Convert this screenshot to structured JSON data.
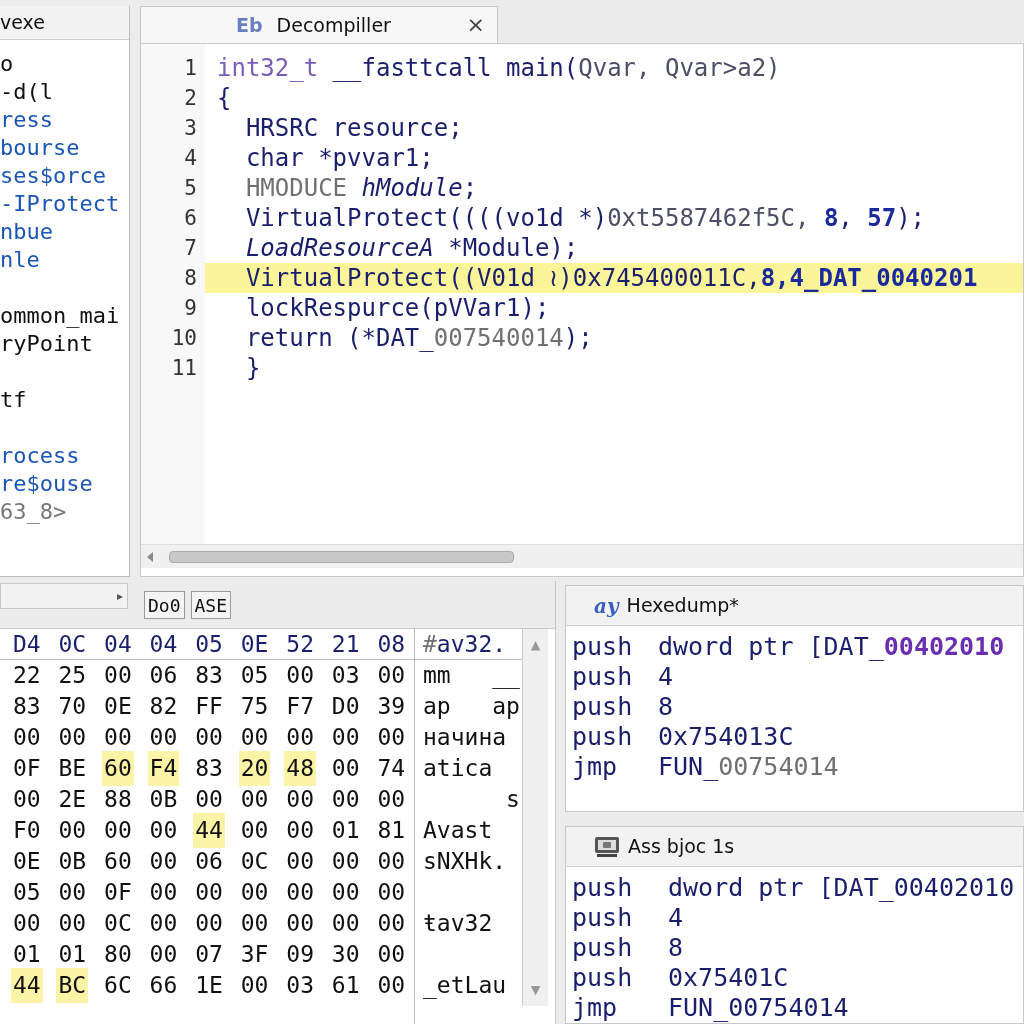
{
  "sidebar": {
    "title": "vexe",
    "items": [
      {
        "text": "o",
        "kind": "plain",
        "gap_before": false
      },
      {
        "text": "-d(l",
        "kind": "plain",
        "gap_before": false
      },
      {
        "text": "ress",
        "kind": "link",
        "gap_before": false
      },
      {
        "text": "bourse",
        "kind": "link",
        "gap_before": false
      },
      {
        "text": "ses$orce",
        "kind": "link",
        "gap_before": false
      },
      {
        "text": "-IProtect",
        "kind": "link",
        "gap_before": false
      },
      {
        "text": "nbue",
        "kind": "link",
        "gap_before": false
      },
      {
        "text": "nle",
        "kind": "link",
        "gap_before": false
      },
      {
        "text": "ommon_mai",
        "kind": "plain",
        "gap_before": true
      },
      {
        "text": "ryPoint",
        "kind": "plain",
        "gap_before": false
      },
      {
        "text": "tf",
        "kind": "plain",
        "gap_before": true
      },
      {
        "text": "rocess",
        "kind": "link",
        "gap_before": true
      },
      {
        "text": "re$ouse",
        "kind": "link",
        "gap_before": false
      },
      {
        "text": "63_8>",
        "kind": "dim",
        "gap_before": false
      }
    ],
    "scroll_arrow": "▸"
  },
  "editor": {
    "tab": {
      "icon": "Eb",
      "title": "Decompiller",
      "close": "×"
    },
    "lines": [
      {
        "number": "1",
        "highlighted": false,
        "segments": [
          {
            "text": "int32_t",
            "kind": "keyword"
          },
          {
            "text": " __fasttcall main(",
            "kind": "plain"
          },
          {
            "text": "Qvar, Qvar>a2)",
            "kind": "muted"
          }
        ]
      },
      {
        "number": "2",
        "highlighted": false,
        "segments": [
          {
            "text": "{",
            "kind": "plain"
          }
        ]
      },
      {
        "number": "3",
        "highlighted": false,
        "segments": [
          {
            "text": "  HRSRC resource;",
            "kind": "plain"
          }
        ]
      },
      {
        "number": "4",
        "highlighted": false,
        "segments": [
          {
            "text": "  char *pvvar1;",
            "kind": "plain"
          }
        ]
      },
      {
        "number": "5",
        "highlighted": false,
        "segments": [
          {
            "text": "  HMODUCE ",
            "kind": "dim"
          },
          {
            "text": "hModule",
            "kind": "italic"
          },
          {
            "text": ";",
            "kind": "plain"
          }
        ]
      },
      {
        "number": "6",
        "highlighted": false,
        "segments": [
          {
            "text": "  VirtualProtect((((vo1d *)",
            "kind": "plain"
          },
          {
            "text": "0xt5587462f5C, ",
            "kind": "muted"
          },
          {
            "text": "8",
            "kind": "number"
          },
          {
            "text": ", ",
            "kind": "plain"
          },
          {
            "text": "57",
            "kind": "number"
          },
          {
            "text": ");",
            "kind": "plain"
          }
        ]
      },
      {
        "number": "7",
        "highlighted": false,
        "segments": [
          {
            "text": "  LoadResourceA",
            "kind": "italic"
          },
          {
            "text": " *Module);",
            "kind": "plain"
          }
        ]
      },
      {
        "number": "8",
        "highlighted": true,
        "segments": [
          {
            "text": "  VirtualProtect((V01d ≀)0x745400011C,",
            "kind": "plain"
          },
          {
            "text": "8",
            "kind": "number"
          },
          {
            "text": ",4_DAT_0040201",
            "kind": "number"
          }
        ]
      },
      {
        "number": "9",
        "highlighted": false,
        "segments": [
          {
            "text": "  lockRespurce(pVVar1);",
            "kind": "plain"
          }
        ]
      },
      {
        "number": "10",
        "highlighted": false,
        "segments": [
          {
            "text": "  return (*DAT_",
            "kind": "plain"
          },
          {
            "text": "007540014",
            "kind": "dim"
          },
          {
            "text": ");",
            "kind": "plain"
          }
        ]
      },
      {
        "number": "11",
        "highlighted": false,
        "segments": [
          {
            "text": "  }",
            "kind": "plain"
          }
        ]
      }
    ]
  },
  "hex": {
    "buttons": [
      "Do0",
      "ASE"
    ],
    "header": {
      "bytes": [
        "D4",
        "0C",
        "04",
        "04",
        "05",
        "0E",
        "52",
        "21",
        "08"
      ],
      "ascii": [
        {
          "text": "#",
          "kind": "dim"
        },
        {
          "text": "av32.",
          "kind": "plain"
        }
      ]
    },
    "rows": [
      {
        "ascii": "mm   __",
        "bytes": [
          {
            "value": "22",
            "highlighted": false
          },
          {
            "value": "25",
            "highlighted": false
          },
          {
            "value": "00",
            "highlighted": false
          },
          {
            "value": "06",
            "highlighted": false
          },
          {
            "value": "83",
            "highlighted": false
          },
          {
            "value": "05",
            "highlighted": false
          },
          {
            "value": "00",
            "highlighted": false
          },
          {
            "value": "03",
            "highlighted": false
          },
          {
            "value": "00",
            "highlighted": false
          }
        ]
      },
      {
        "ascii": "ap   ap",
        "bytes": [
          {
            "value": "83",
            "highlighted": false
          },
          {
            "value": "70",
            "highlighted": false
          },
          {
            "value": "0E",
            "highlighted": false
          },
          {
            "value": "82",
            "highlighted": false
          },
          {
            "value": "FF",
            "highlighted": false
          },
          {
            "value": "75",
            "highlighted": false
          },
          {
            "value": "F7",
            "highlighted": false
          },
          {
            "value": "D0",
            "highlighted": false
          },
          {
            "value": "39",
            "highlighted": false
          }
        ]
      },
      {
        "ascii": "начина",
        "bytes": [
          {
            "value": "00",
            "highlighted": false
          },
          {
            "value": "00",
            "highlighted": false
          },
          {
            "value": "00",
            "highlighted": false
          },
          {
            "value": "00",
            "highlighted": false
          },
          {
            "value": "00",
            "highlighted": false
          },
          {
            "value": "00",
            "highlighted": false
          },
          {
            "value": "00",
            "highlighted": false
          },
          {
            "value": "00",
            "highlighted": false
          },
          {
            "value": "00",
            "highlighted": false
          }
        ]
      },
      {
        "ascii": "atica",
        "bytes": [
          {
            "value": "0F",
            "highlighted": false
          },
          {
            "value": "BE",
            "highlighted": false
          },
          {
            "value": "60",
            "highlighted": true
          },
          {
            "value": "F4",
            "highlighted": true
          },
          {
            "value": "83",
            "highlighted": false
          },
          {
            "value": "20",
            "highlighted": true
          },
          {
            "value": "48",
            "highlighted": true
          },
          {
            "value": "00",
            "highlighted": false
          },
          {
            "value": "74",
            "highlighted": false
          }
        ]
      },
      {
        "ascii": "      s",
        "bytes": [
          {
            "value": "00",
            "highlighted": false
          },
          {
            "value": "2E",
            "highlighted": false
          },
          {
            "value": "88",
            "highlighted": false
          },
          {
            "value": "0B",
            "highlighted": false
          },
          {
            "value": "00",
            "highlighted": false
          },
          {
            "value": "00",
            "highlighted": false
          },
          {
            "value": "00",
            "highlighted": false
          },
          {
            "value": "00",
            "highlighted": false
          },
          {
            "value": "00",
            "highlighted": false
          }
        ]
      },
      {
        "ascii": "Avast",
        "bytes": [
          {
            "value": "F0",
            "highlighted": false
          },
          {
            "value": "00",
            "highlighted": false
          },
          {
            "value": "00",
            "highlighted": false
          },
          {
            "value": "00",
            "highlighted": false
          },
          {
            "value": "44",
            "highlighted": true
          },
          {
            "value": "00",
            "highlighted": false
          },
          {
            "value": "00",
            "highlighted": false
          },
          {
            "value": "01",
            "highlighted": false
          },
          {
            "value": "81",
            "highlighted": false
          }
        ]
      },
      {
        "ascii": "sNXHk.",
        "bytes": [
          {
            "value": "0E",
            "highlighted": false
          },
          {
            "value": "0B",
            "highlighted": false
          },
          {
            "value": "60",
            "highlighted": false
          },
          {
            "value": "00",
            "highlighted": false
          },
          {
            "value": "06",
            "highlighted": false
          },
          {
            "value": "0C",
            "highlighted": false
          },
          {
            "value": "00",
            "highlighted": false
          },
          {
            "value": "00",
            "highlighted": false
          },
          {
            "value": "00",
            "highlighted": false
          }
        ]
      },
      {
        "bytes": [
          {
            "value": "05",
            "highlighted": false
          },
          {
            "value": "00",
            "highlighted": false
          },
          {
            "value": "0F",
            "highlighted": false
          },
          {
            "value": "00",
            "highlighted": false
          },
          {
            "value": "00",
            "highlighted": false
          },
          {
            "value": "00",
            "highlighted": false
          },
          {
            "value": "00",
            "highlighted": false
          },
          {
            "value": "00",
            "highlighted": false
          },
          {
            "value": "00",
            "highlighted": false
          }
        ]
      },
      {
        "ascii": "ŧav32",
        "bytes": [
          {
            "value": "00",
            "highlighted": false
          },
          {
            "value": "00",
            "highlighted": false
          },
          {
            "value": "0C",
            "highlighted": false
          },
          {
            "value": "00",
            "highlighted": false
          },
          {
            "value": "00",
            "highlighted": false
          },
          {
            "value": "00",
            "highlighted": false
          },
          {
            "value": "00",
            "highlighted": false
          },
          {
            "value": "00",
            "highlighted": false
          },
          {
            "value": "00",
            "highlighted": false
          }
        ]
      },
      {
        "bytes": [
          {
            "value": "01",
            "highlighted": false
          },
          {
            "value": "01",
            "highlighted": false
          },
          {
            "value": "80",
            "highlighted": false
          },
          {
            "value": "00",
            "highlighted": false
          },
          {
            "value": "07",
            "highlighted": false
          },
          {
            "value": "3F",
            "highlighted": false
          },
          {
            "value": "09",
            "highlighted": false
          },
          {
            "value": "30",
            "highlighted": false
          },
          {
            "value": "00",
            "highlighted": false
          }
        ]
      },
      {
        "ascii": "_etLau",
        "bytes": [
          {
            "value": "44",
            "highlighted": true
          },
          {
            "value": "BC",
            "highlighted": true
          },
          {
            "value": "6C",
            "highlighted": false
          },
          {
            "value": "66",
            "highlighted": false
          },
          {
            "value": "1E",
            "highlighted": false
          },
          {
            "value": "00",
            "highlighted": false
          },
          {
            "value": "03",
            "highlighted": false
          },
          {
            "value": "61",
            "highlighted": false
          },
          {
            "value": "00",
            "highlighted": false
          }
        ]
      }
    ],
    "scroll_up": "▲",
    "scroll_down": "▼"
  },
  "panels": [
    {
      "title": "Hexedump*",
      "icon": "ay",
      "kind": "hexdump",
      "lines": [
        {
          "mnemonic": "push",
          "operand": [
            {
              "text": "dword ptr [DAT_",
              "kind": "plain"
            },
            {
              "text": "00402010",
              "kind": "accent"
            }
          ]
        },
        {
          "mnemonic": "push",
          "operand": [
            {
              "text": "4",
              "kind": "plain"
            }
          ]
        },
        {
          "mnemonic": "push",
          "operand": [
            {
              "text": "8",
              "kind": "plain"
            }
          ]
        },
        {
          "mnemonic": "push",
          "operand": [
            {
              "text": "0x754013C",
              "kind": "plain"
            }
          ]
        },
        {
          "mnemonic": "jmp",
          "operand": [
            {
              "text": "FUN_",
              "kind": "plain"
            },
            {
              "text": "00754014",
              "kind": "dim"
            }
          ]
        }
      ]
    },
    {
      "title": "Ass bjoc 1s",
      "kind": "assembly",
      "lines": [
        {
          "mnemonic": "push",
          "operand": [
            {
              "text": "dword ptr [DAT_00402010",
              "kind": "plain"
            }
          ]
        },
        {
          "mnemonic": "push",
          "operand": [
            {
              "text": "4",
              "kind": "plain"
            }
          ]
        },
        {
          "mnemonic": "push",
          "operand": [
            {
              "text": "8",
              "kind": "plain"
            }
          ]
        },
        {
          "mnemonic": "push",
          "operand": [
            {
              "text": "0x75401C",
              "kind": "plain"
            }
          ]
        },
        {
          "mnemonic": "jmp",
          "operand": [
            {
              "text": "FUN_00754014",
              "kind": "plain"
            }
          ]
        }
      ]
    }
  ]
}
